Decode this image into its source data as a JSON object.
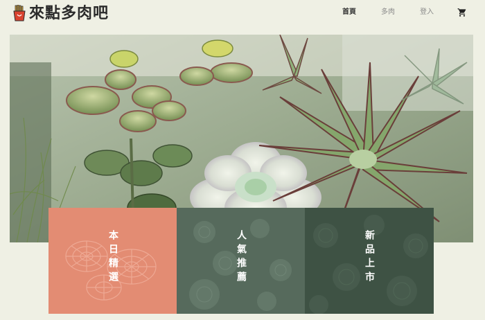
{
  "brand": {
    "name": "來點多肉吧",
    "logo_icon": "fries-box-icon"
  },
  "nav": {
    "items": [
      {
        "label": "首頁",
        "active": true
      },
      {
        "label": "多肉",
        "active": false
      },
      {
        "label": "登入",
        "active": false
      }
    ],
    "cart_icon": "cart-icon"
  },
  "hero": {
    "alt": "succulent plants"
  },
  "cards": [
    {
      "title": "本日精選",
      "color": "#e38c73"
    },
    {
      "title": "人氣推薦",
      "color": "#566a5c"
    },
    {
      "title": "新品上市",
      "color": "#3e5244"
    }
  ],
  "colors": {
    "background": "#eff0e4",
    "accent": "#e38c73",
    "dark_green": "#3e5244"
  }
}
